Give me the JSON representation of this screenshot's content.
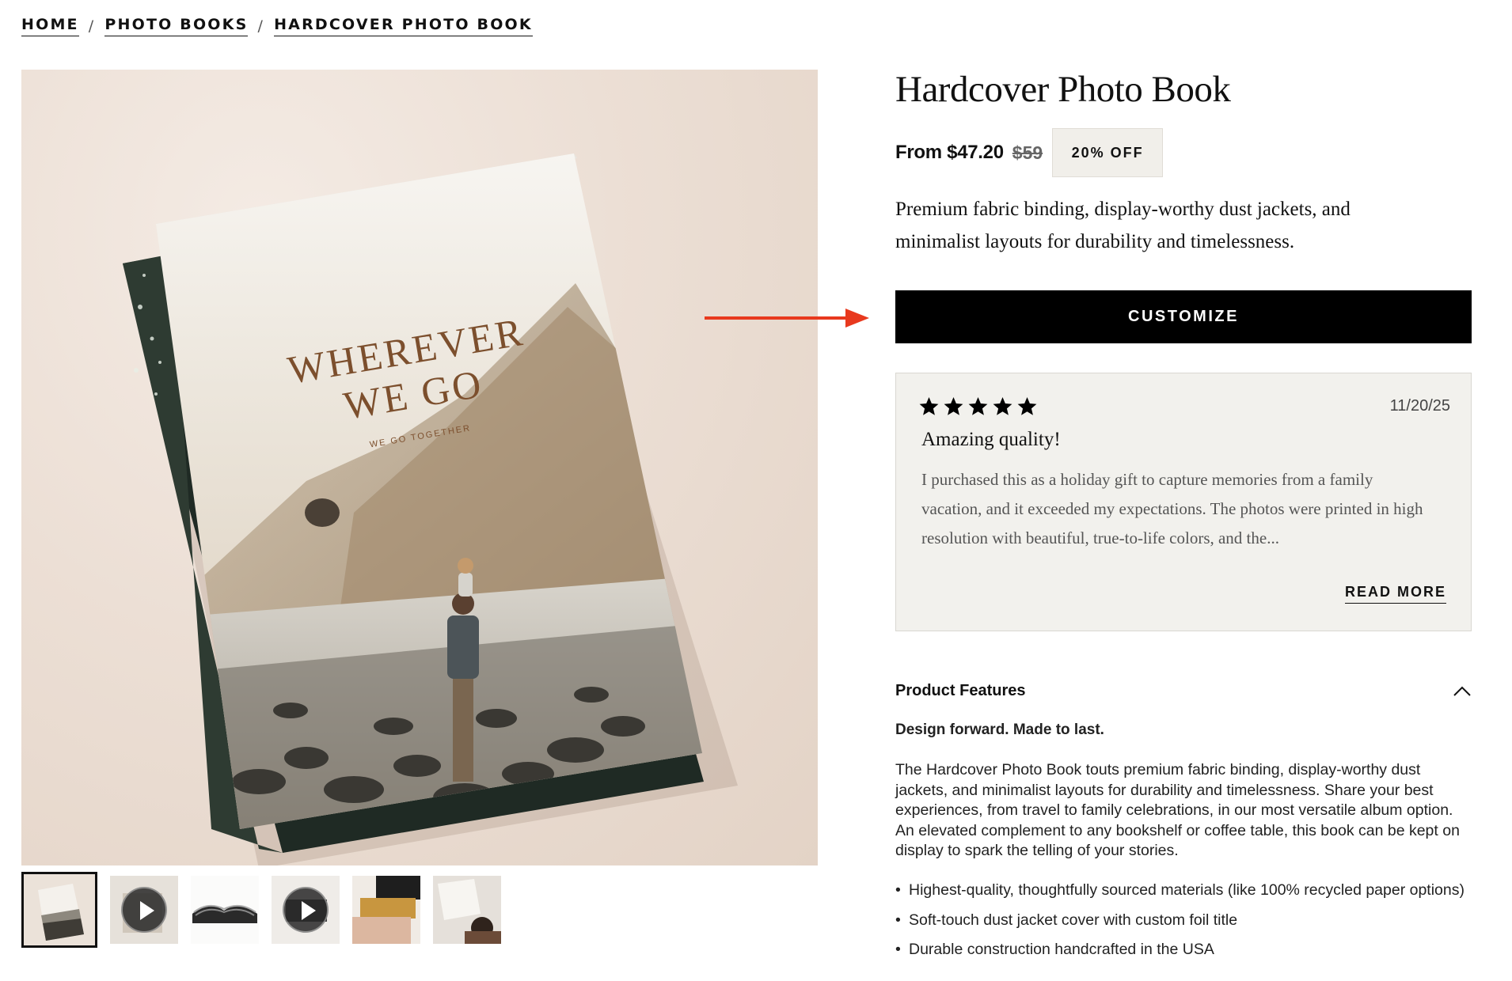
{
  "breadcrumb": {
    "items": [
      "HOME",
      "PHOTO BOOKS",
      "HARDCOVER PHOTO BOOK"
    ],
    "separator": "/"
  },
  "gallery": {
    "cover_title_line1": "WHEREVER",
    "cover_title_line2": "WE GO",
    "cover_subtitle": "WE GO TOGETHER",
    "thumbnails": [
      {
        "name": "thumb-cover",
        "type": "image",
        "active": true
      },
      {
        "name": "thumb-video-1",
        "type": "video",
        "active": false
      },
      {
        "name": "thumb-open-book",
        "type": "image",
        "active": false
      },
      {
        "name": "thumb-video-2",
        "type": "video",
        "active": false
      },
      {
        "name": "thumb-fabric-swatches",
        "type": "image",
        "active": false
      },
      {
        "name": "thumb-lifestyle",
        "type": "image",
        "active": false
      }
    ]
  },
  "product": {
    "title": "Hardcover Photo Book",
    "price_from": "From $47.20",
    "price_original": "$59",
    "discount_badge": "20% OFF",
    "description": "Premium fabric binding, display-worthy dust jackets, and minimalist layouts for durability and timelessness.",
    "cta_label": "CUSTOMIZE"
  },
  "review": {
    "rating": 5,
    "rating_max": 5,
    "date": "11/20/25",
    "title": "Amazing quality!",
    "body": "I purchased this as a holiday gift to capture memories from a family vacation, and it exceeded my expectations. The photos were printed in high resolution with beautiful, true-to-life colors, and the...",
    "read_more_label": "READ MORE"
  },
  "features": {
    "heading": "Product Features",
    "subheading": "Design forward. Made to last.",
    "body": "The Hardcover Photo Book touts premium fabric binding, display-worthy dust jackets, and minimalist layouts for durability and timelessness. Share your best experiences, from travel to family celebrations, in our most versatile album option. An elevated complement to any bookshelf or coffee table, this book can be kept on display to spark the telling of your stories.",
    "bullet_char": "•",
    "bullets": [
      "Highest-quality, thoughtfully sourced materials (like 100% recycled paper options)",
      "Soft-touch dust jacket cover with custom foil title",
      "Durable construction handcrafted in the USA"
    ]
  },
  "colors": {
    "accent_arrow": "#e8391e",
    "cta_background": "#000000",
    "review_background": "#f2f1ed",
    "badge_background": "#f1efea"
  }
}
